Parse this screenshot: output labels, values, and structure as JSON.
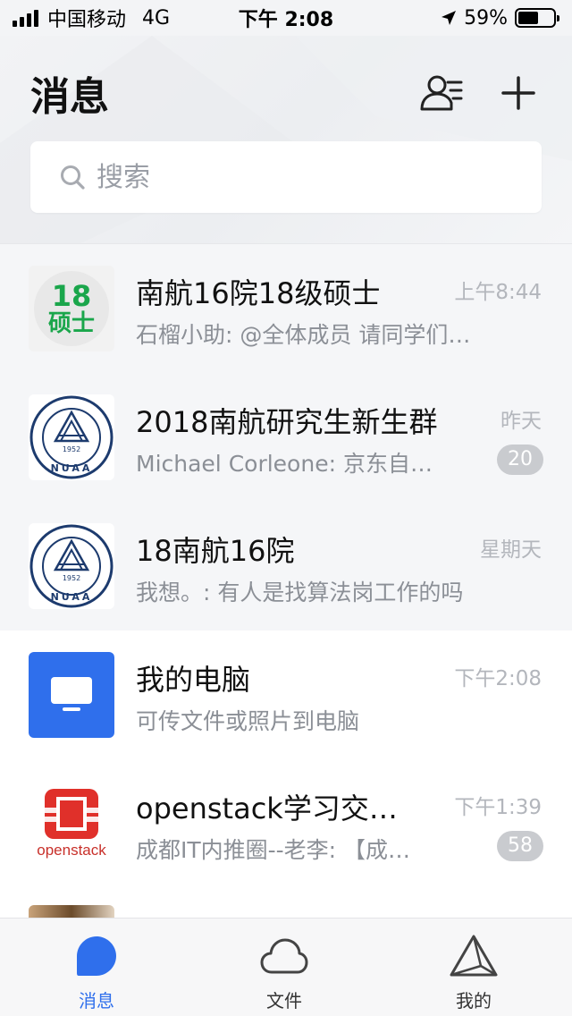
{
  "status": {
    "carrier": "中国移动",
    "network": "4G",
    "time": "下午 2:08",
    "battery_percent": "59%",
    "battery_level": 0.59
  },
  "header": {
    "title": "消息",
    "search_placeholder": "搜索"
  },
  "conversations": [
    {
      "title": "南航16院18级硕士",
      "subtitle": "石榴小助: @全体成员  请同学们…",
      "time": "上午8:44",
      "badge": "",
      "avatar_text_top": "18",
      "avatar_text_bottom": "硕士",
      "pinned": true
    },
    {
      "title": "2018南航研究生新生群",
      "subtitle": "Michael  Corleone: 京东自…",
      "time": "昨天",
      "badge": "20",
      "pinned": true
    },
    {
      "title": "18南航16院",
      "subtitle": "我想。: 有人是找算法岗工作的吗",
      "time": "星期天",
      "badge": "",
      "pinned": true
    },
    {
      "title": "我的电脑",
      "subtitle": "可传文件或照片到电脑",
      "time": "下午2:08",
      "badge": "",
      "pinned": false
    },
    {
      "title": "openstack学习交…",
      "subtitle": "成都IT内推圈--老李: 【成…",
      "time": "下午1:39",
      "badge": "58",
      "avatar_text": "openstack",
      "pinned": false
    }
  ],
  "seal_text": {
    "year": "1952",
    "abbr": "NUAA"
  },
  "tabs": [
    {
      "label": "消息"
    },
    {
      "label": "文件"
    },
    {
      "label": "我的"
    }
  ],
  "colors": {
    "accent": "#2f6fec",
    "badge": "#c9cbcf",
    "seal": "#1d3b6e",
    "avatar_green": "#1aa64b",
    "openstack_red": "#e0302a"
  }
}
